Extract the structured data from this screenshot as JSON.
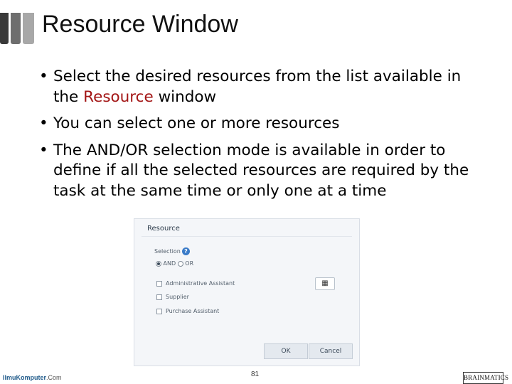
{
  "slide": {
    "title": "Resource Window",
    "bullets": [
      {
        "before": "Select the desired resources from the list available in the ",
        "highlight": "Resource",
        "after": " window"
      },
      {
        "before": "You can select one or more resources",
        "highlight": "",
        "after": ""
      },
      {
        "before": "The AND/OR selection mode is available in order to define if all the selected resources are required by the task at the same time or only one at a time",
        "highlight": "",
        "after": ""
      }
    ],
    "bullet_glyph": "•",
    "accent_color": "#a31515",
    "bar_colors": [
      "#3a3a3a",
      "#6e6e6e",
      "#a8a8a8"
    ]
  },
  "resource_panel": {
    "title": "Resource",
    "selection_label": "Selection",
    "help_icon_glyph": "?",
    "modes": [
      {
        "label": "AND",
        "checked": true
      },
      {
        "label": "OR",
        "checked": false
      }
    ],
    "resources": [
      {
        "label": "Administrative Assistant",
        "checked": false
      },
      {
        "label": "Supplier",
        "checked": false
      },
      {
        "label": "Purchase Assistant",
        "checked": false
      }
    ],
    "picker_icon_glyph": "▦",
    "ok_label": "OK",
    "cancel_label": "Cancel"
  },
  "footer": {
    "page_number": "81",
    "left_brand": "IlmuKomputer",
    "left_brand_tld": ".Com",
    "right_brand": "BRAINMATICS"
  }
}
